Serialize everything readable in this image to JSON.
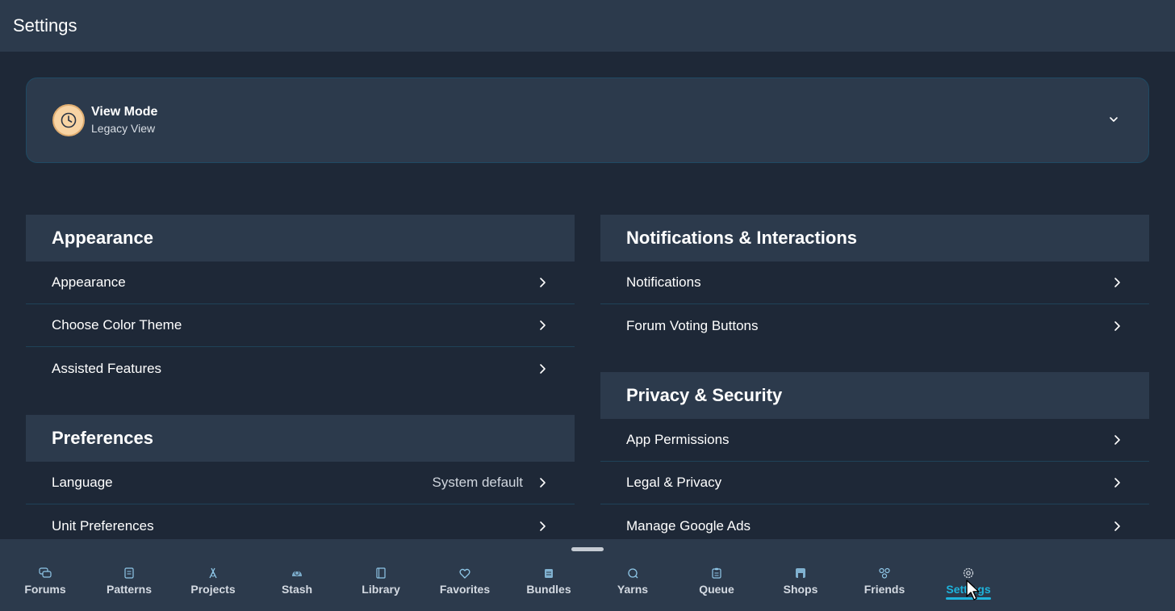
{
  "header": {
    "title": "Settings"
  },
  "view_mode": {
    "title": "View Mode",
    "subtitle": "Legacy View",
    "icon": "clock-icon"
  },
  "sections": {
    "appearance": {
      "title": "Appearance",
      "items": [
        {
          "label": "Appearance"
        },
        {
          "label": "Choose Color Theme"
        },
        {
          "label": "Assisted Features"
        }
      ]
    },
    "preferences": {
      "title": "Preferences",
      "items": [
        {
          "label": "Language",
          "value": "System default"
        },
        {
          "label": "Unit Preferences"
        }
      ]
    },
    "notifications": {
      "title": "Notifications & Interactions",
      "items": [
        {
          "label": "Notifications"
        },
        {
          "label": "Forum Voting Buttons"
        }
      ]
    },
    "privacy": {
      "title": "Privacy & Security",
      "items": [
        {
          "label": "App Permissions"
        },
        {
          "label": "Legal & Privacy"
        },
        {
          "label": "Manage Google Ads"
        }
      ]
    }
  },
  "nav": {
    "items": [
      {
        "label": "Forums",
        "icon": "forums-icon"
      },
      {
        "label": "Patterns",
        "icon": "patterns-icon"
      },
      {
        "label": "Projects",
        "icon": "projects-icon"
      },
      {
        "label": "Stash",
        "icon": "stash-icon"
      },
      {
        "label": "Library",
        "icon": "library-icon"
      },
      {
        "label": "Favorites",
        "icon": "heart-icon"
      },
      {
        "label": "Bundles",
        "icon": "bundles-icon"
      },
      {
        "label": "Yarns",
        "icon": "yarn-icon"
      },
      {
        "label": "Queue",
        "icon": "queue-icon"
      },
      {
        "label": "Shops",
        "icon": "shop-icon"
      },
      {
        "label": "Friends",
        "icon": "friends-icon"
      },
      {
        "label": "Settings",
        "icon": "gear-icon",
        "active": true
      }
    ]
  },
  "colors": {
    "accent": "#1eb3dc",
    "background": "#1e2837",
    "panel": "#2c3a4c"
  }
}
